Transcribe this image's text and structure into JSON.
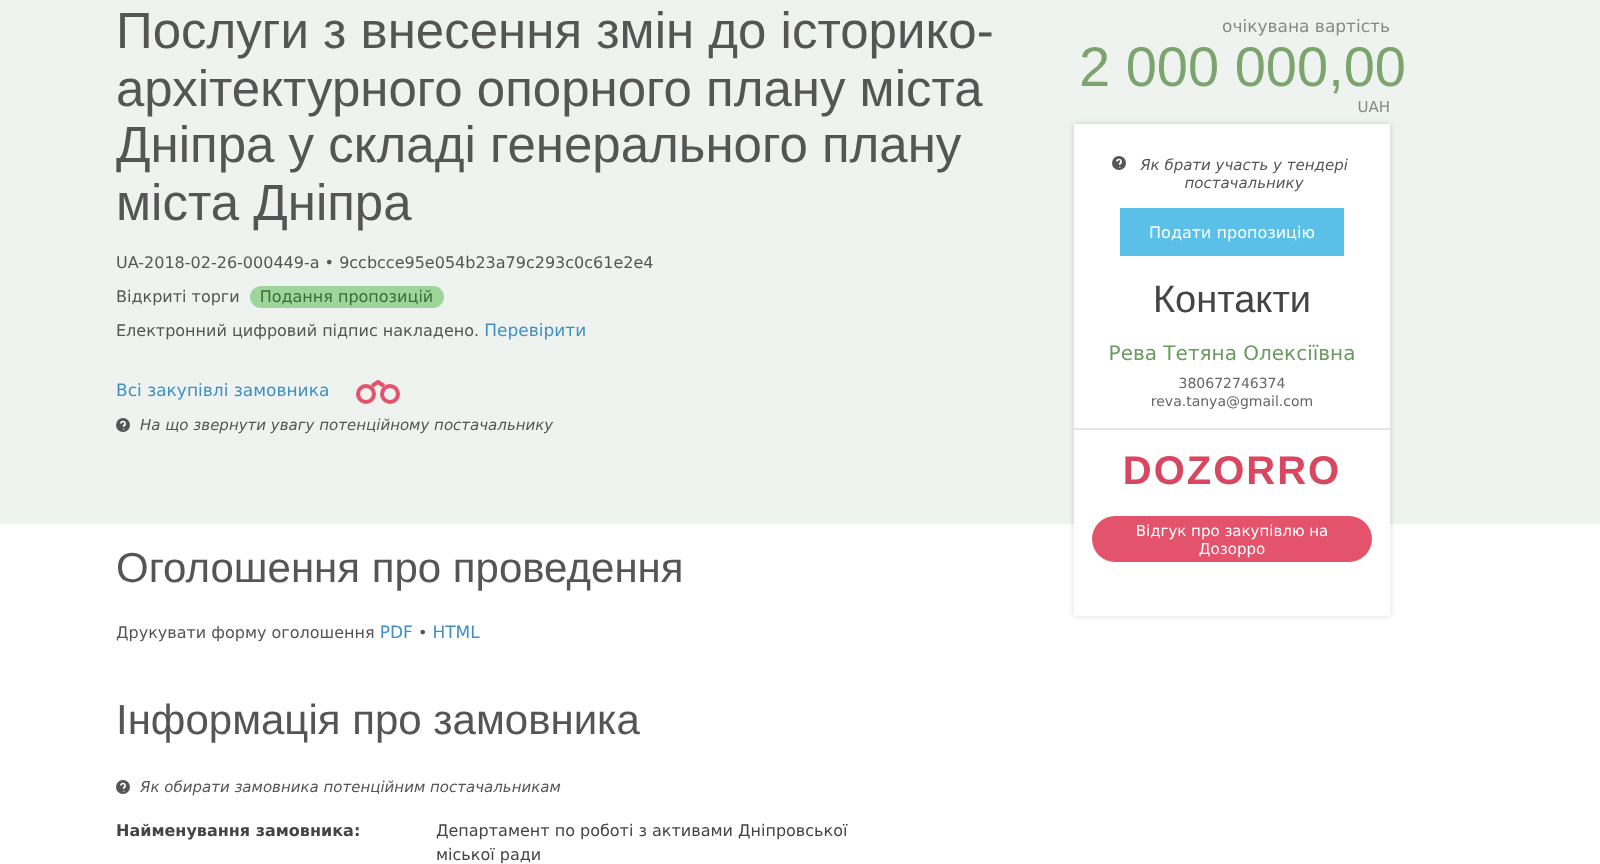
{
  "tender": {
    "title": "Послуги з внесення змін до історико-архітектурного опорного плану міста Дніпра у складі генерального плану міста Дніпра",
    "id": "UA-2018-02-26-000449-a",
    "separator": "•",
    "hash": "9ccbcce95e054b23a79c293c0c61e2e4",
    "procedure": "Відкриті торги",
    "status": "Подання пропозицій",
    "signature": "Електронний цифровий підпис накладено.",
    "signature_link": "Перевірити",
    "buyer_link": "Всі закупівлі замовника",
    "hint": "На що звернути увагу потенційному постачальнику"
  },
  "price": {
    "label": "очікувана вартість",
    "amount": "2 000 000,00",
    "currency": "UAH"
  },
  "card": {
    "hint": "Як брати участь у тендері постачальнику",
    "button": "Подати пропозицію",
    "contacts_title": "Контакти",
    "name": "Рева Тетяна Олексіївна",
    "phone": "380672746374",
    "email": "reva.tanya@gmail.com",
    "logo": "DOZORRO",
    "feedback_button": "Відгук про закупівлю на Дозорро"
  },
  "announcement": {
    "title": "Оголошення про проведення",
    "print_label": "Друкувати форму оголошення",
    "links": [
      "PDF",
      "HTML"
    ],
    "separator": "•"
  },
  "buyer": {
    "title": "Інформація про замовника",
    "hint": "Як обирати замовника потенційним постачальникам",
    "rows": [
      {
        "label": "Найменування замовника:",
        "value": "Департамент по роботі з активами Дніпровської міської ради"
      }
    ]
  }
}
